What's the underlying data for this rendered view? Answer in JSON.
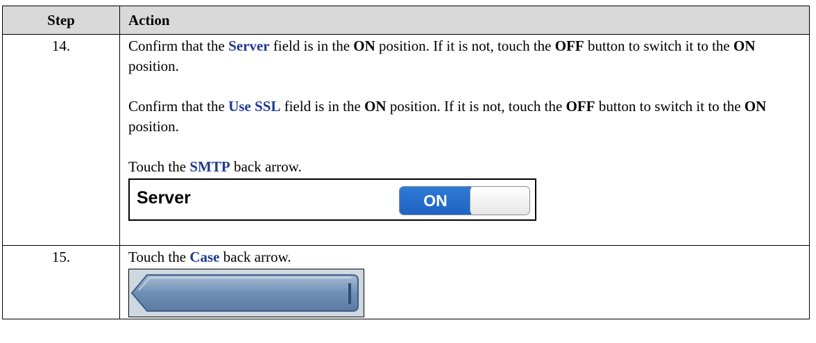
{
  "table": {
    "headers": {
      "step": "Step",
      "action": "Action"
    },
    "rows": [
      {
        "step": "14.",
        "paragraphs": [
          {
            "p1": "Confirm that the ",
            "term": "Server",
            "p2": " field is in the ",
            "b1": "ON",
            "p3": " position.  If it is not, touch the ",
            "b2": "OFF",
            "p4": " button to switch it to the ",
            "b3": "ON",
            "p5": " position."
          },
          {
            "p1": "Confirm that the ",
            "term": "Use SSL",
            "p2": " field is in the ",
            "b1": "ON",
            "p3": " position.  If it is not, touch the ",
            "b2": "OFF",
            "p4": " button to switch it to the ",
            "b3": "ON",
            "p5": " position."
          },
          {
            "p1": "Touch the ",
            "term": "SMTP",
            "p2": " back arrow."
          }
        ],
        "screenshot": {
          "label": "Server",
          "toggle_state": "ON"
        }
      },
      {
        "step": "15.",
        "instruction": {
          "p1": "Touch the ",
          "term": "Case",
          "p2": " back arrow."
        },
        "screenshot": {
          "icon": "back-arrow-button"
        }
      }
    ]
  },
  "colors": {
    "ui_term": "#1f3a93",
    "header_bg": "#d9d9d9",
    "toggle_on": "#1e63c3"
  }
}
